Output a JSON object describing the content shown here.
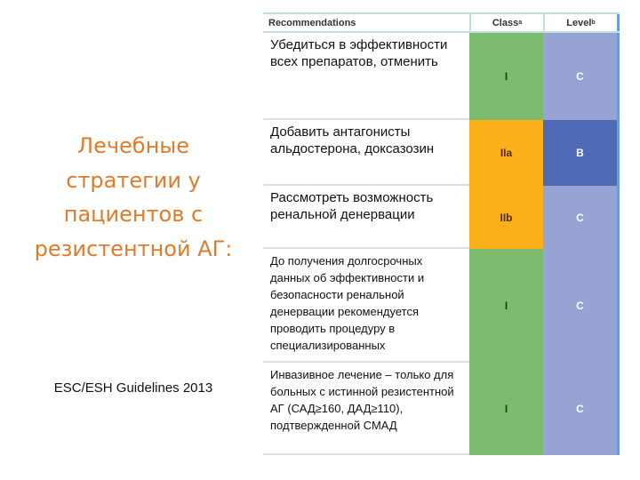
{
  "title": {
    "lines": [
      "Лечебные",
      "стратегии у",
      "пациентов с",
      "резистентной АГ:"
    ]
  },
  "footer": "ESC/ESH Guidelines 2013",
  "table": {
    "headers": {
      "recommendations": "Recommendations",
      "class": "Class",
      "class_sup": "a",
      "level": "Level",
      "level_sup": "b"
    },
    "colors": {
      "green": "#7dbb6f",
      "orange": "#fbb01a",
      "lavender": "#96a3d3",
      "blue": "#4f6ab5"
    },
    "rows": [
      {
        "text": "Убедиться в эффективности всех препаратов, отменить",
        "class": "I",
        "level": "C",
        "class_color": "#7dbb6f",
        "level_color": "#96a3d3"
      },
      {
        "text": "Добавить антагонисты альдостерона, доксазозин",
        "class": "IIa",
        "level": "B",
        "class_color": "#fbb01a",
        "level_color": "#4f6ab5"
      },
      {
        "text": "Рассмотреть возможность ренальной денервации",
        "class": "IIb",
        "level": "C",
        "class_color": "#fbb01a",
        "level_color": "#96a3d3"
      },
      {
        "text": "До получения долгосрочных данных об эффективности и безопасности ренальной денервации рекомендуется проводить процедуру в специализированных",
        "class": "I",
        "level": "C",
        "class_color": "#7dbb6f",
        "level_color": "#96a3d3"
      },
      {
        "text": "Инвазивное лечение – только для больных с истинной резистентной АГ (САД≥160, ДАД≥110), подтвержденной СМАД",
        "class": "I",
        "level": "C",
        "class_color": "#7dbb6f",
        "level_color": "#96a3d3"
      }
    ]
  }
}
